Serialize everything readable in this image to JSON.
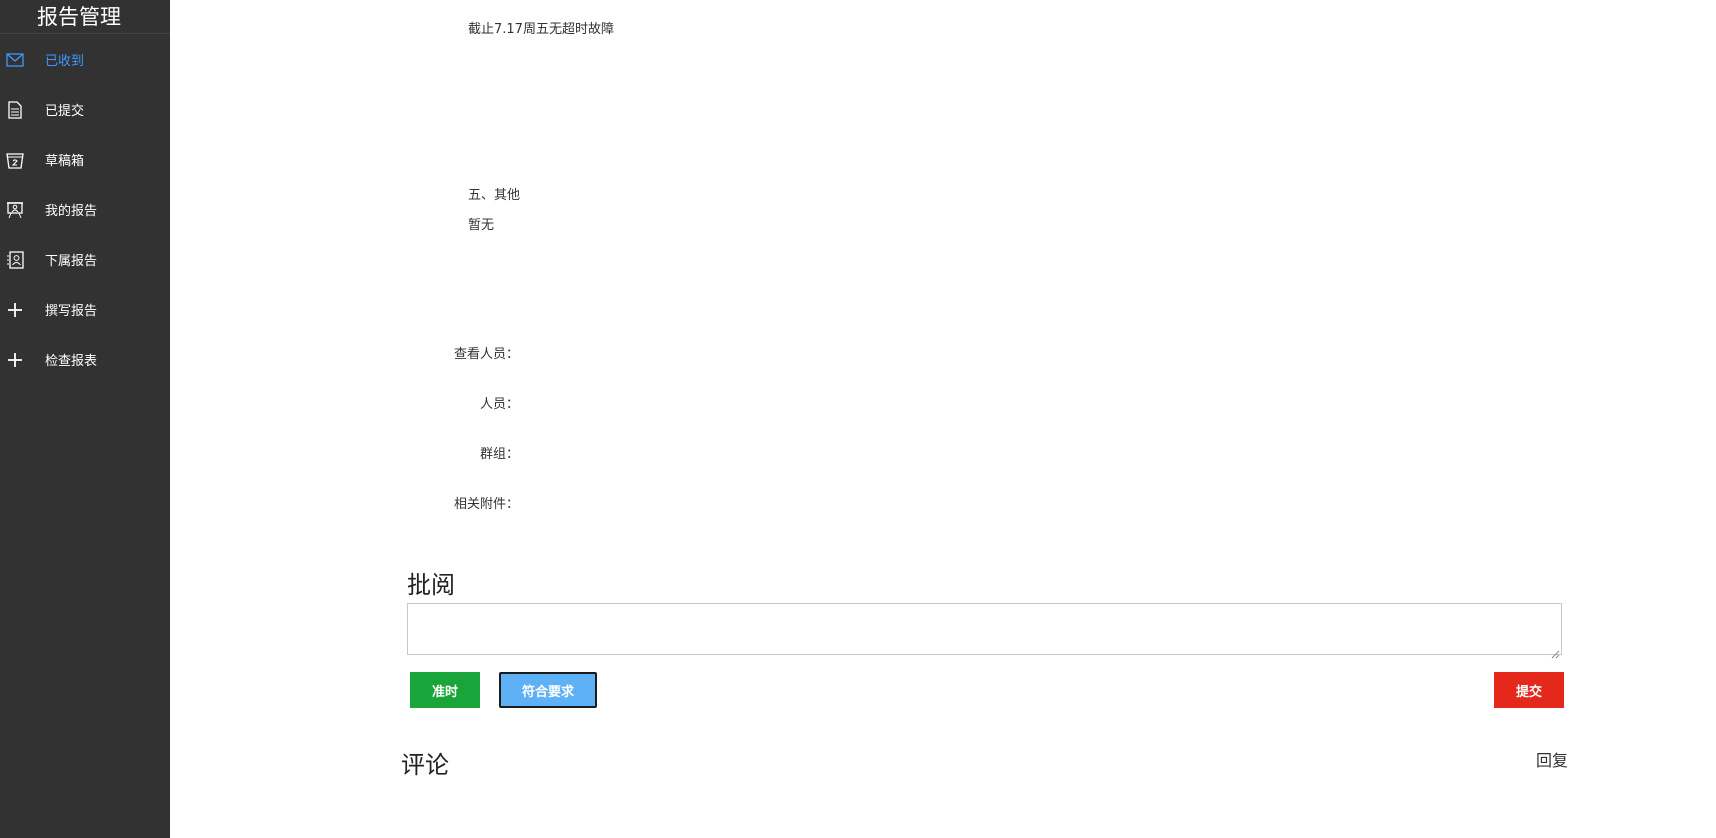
{
  "sidebar": {
    "title": "报告管理",
    "items": [
      {
        "label": "已收到",
        "icon": "mail-icon"
      },
      {
        "label": "已提交",
        "icon": "document-icon"
      },
      {
        "label": "草稿箱",
        "icon": "drafts-icon"
      },
      {
        "label": "我的报告",
        "icon": "presentation-icon"
      },
      {
        "label": "下属报告",
        "icon": "contact-card-icon"
      },
      {
        "label": "撰写报告",
        "icon": "plus-icon"
      },
      {
        "label": "检查报表",
        "icon": "plus-icon"
      }
    ]
  },
  "report": {
    "line1": "截止7.17周五无超时故障",
    "section5_title": "五、其他",
    "section5_body": "暂无"
  },
  "meta": {
    "viewers_label": "查看人员：",
    "people_label": "人员：",
    "groups_label": "群组：",
    "attachments_label": "相关附件："
  },
  "review": {
    "title": "批阅",
    "textarea_value": "",
    "btn_ontime": "准时",
    "btn_meets": "符合要求",
    "btn_submit": "提交"
  },
  "comments": {
    "title": "评论",
    "reply": "回复"
  },
  "colors": {
    "sidebar_bg": "#323232",
    "active": "#3d97ff",
    "green": "#1aa53a",
    "blue": "#5fb1f6",
    "red": "#e4281c"
  }
}
